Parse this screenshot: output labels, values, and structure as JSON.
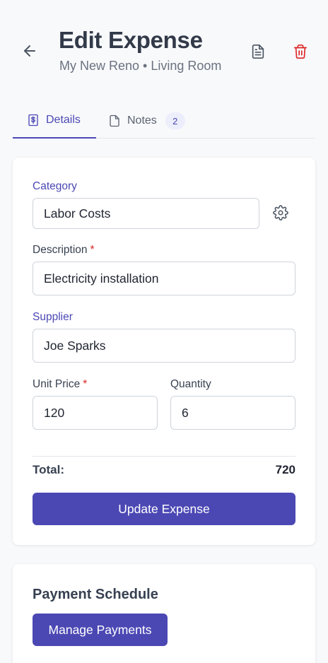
{
  "header": {
    "title": "Edit Expense",
    "subtitle": "My New Reno • Living Room"
  },
  "icons": {
    "back": "arrow-left-icon",
    "document": "document-icon",
    "trash": "trash-icon",
    "settings": "gear-icon",
    "details_tab": "receipt-dollar-icon",
    "notes_tab": "note-page-icon"
  },
  "colors": {
    "accent": "#4b48b4",
    "danger": "#dc2626",
    "background": "#f8f9fb"
  },
  "tabs": {
    "details": {
      "label": "Details",
      "active": true
    },
    "notes": {
      "label": "Notes",
      "count": "2",
      "active": false
    }
  },
  "form": {
    "category": {
      "label": "Category",
      "value": "Labor Costs"
    },
    "description": {
      "label": "Description",
      "required_mark": "*",
      "value": "Electricity installation"
    },
    "supplier": {
      "label": "Supplier",
      "value": "Joe Sparks"
    },
    "unit_price": {
      "label": "Unit Price",
      "required_mark": "*",
      "value": "120"
    },
    "quantity": {
      "label": "Quantity",
      "value": "6"
    },
    "total_label": "Total:",
    "total_value": "720",
    "submit_label": "Update Expense"
  },
  "payment": {
    "title": "Payment Schedule",
    "button_label": "Manage Payments"
  }
}
